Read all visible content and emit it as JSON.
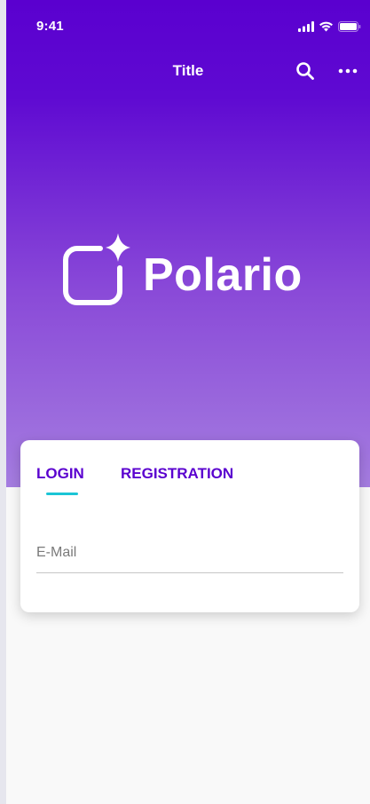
{
  "status_bar": {
    "time": "9:41",
    "icons": [
      "signal-icon",
      "wifi-icon",
      "battery-icon"
    ]
  },
  "nav_bar": {
    "title": "Title",
    "actions": [
      "search-icon",
      "more-icon"
    ]
  },
  "brand": {
    "name": "Polario",
    "mark_icon": "rounded-square-sparkle-icon"
  },
  "auth_card": {
    "tabs": [
      {
        "label": "LOGIN",
        "selected": true
      },
      {
        "label": "REGISTRATION",
        "selected": false
      }
    ],
    "email": {
      "placeholder": "E-Mail",
      "value": ""
    }
  },
  "colors": {
    "primary": "#5a00cf",
    "gradient_end": "#a57de0",
    "tab_indicator": "#1bc5d6",
    "background": "#f9f9f9"
  }
}
